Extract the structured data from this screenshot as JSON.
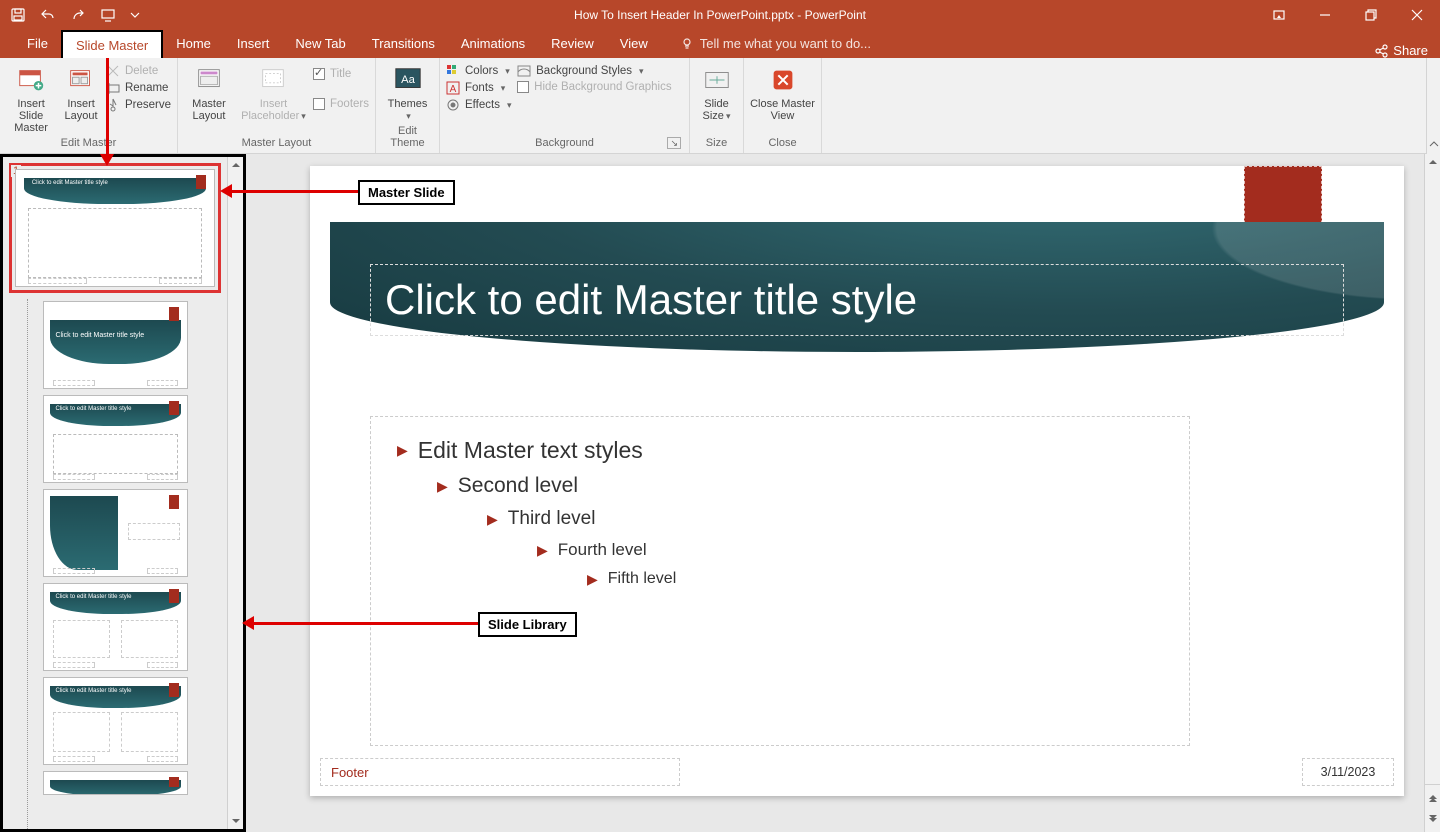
{
  "titlebar": {
    "doc_title": "How To Insert Header In PowerPoint.pptx - PowerPoint"
  },
  "tabs": {
    "file": "File",
    "slide_master": "Slide Master",
    "home": "Home",
    "insert": "Insert",
    "new_tab": "New Tab",
    "transitions": "Transitions",
    "animations": "Animations",
    "review": "Review",
    "view": "View",
    "tell_me": "Tell me what you want to do...",
    "share": "Share"
  },
  "ribbon": {
    "edit_master_group": "Edit Master",
    "insert_slide_master": "Insert Slide Master",
    "insert_layout": "Insert Layout",
    "delete": "Delete",
    "rename": "Rename",
    "preserve": "Preserve",
    "master_layout_group": "Master Layout",
    "master_layout": "Master Layout",
    "insert_placeholder": "Insert Placeholder",
    "title_chk": "Title",
    "footers_chk": "Footers",
    "edit_theme_group": "Edit Theme",
    "themes": "Themes",
    "background_group": "Background",
    "colors": "Colors",
    "fonts": "Fonts",
    "effects": "Effects",
    "background_styles": "Background Styles",
    "hide_bg": "Hide Background Graphics",
    "size_group": "Size",
    "slide_size": "Slide Size",
    "close_group": "Close",
    "close_master": "Close Master View"
  },
  "thumbs": {
    "master_num": "1",
    "thumb_title": "Click to edit Master title style",
    "thumb_title_wrapped": "Click to edit Master title style"
  },
  "slide": {
    "title": "Click to edit Master title style",
    "page_num": "‹#›",
    "lvl1": "Edit Master text styles",
    "lvl2": "Second level",
    "lvl3": "Third level",
    "lvl4": "Fourth level",
    "lvl5": "Fifth level",
    "footer": "Footer",
    "date": "3/11/2023"
  },
  "annotations": {
    "master_slide": "Master Slide",
    "slide_library": "Slide Library"
  }
}
